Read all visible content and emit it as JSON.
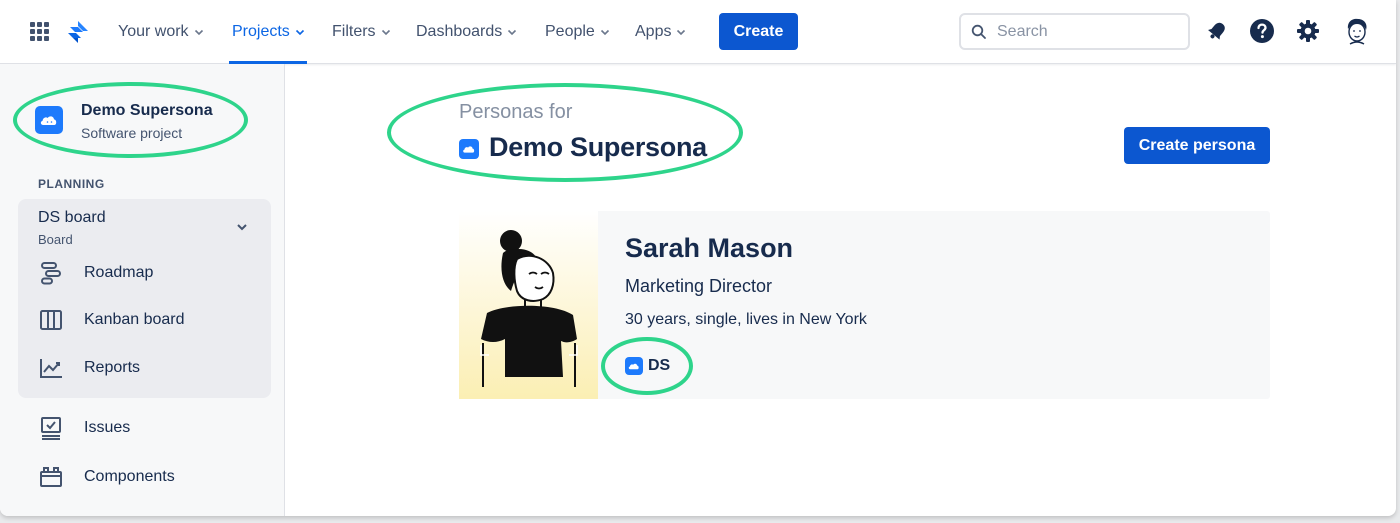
{
  "topnav": {
    "items": [
      {
        "label": "Your work"
      },
      {
        "label": "Projects"
      },
      {
        "label": "Filters"
      },
      {
        "label": "Dashboards"
      },
      {
        "label": "People"
      },
      {
        "label": "Apps"
      }
    ],
    "active": "Projects",
    "create_label": "Create",
    "search_placeholder": "Search"
  },
  "sidebar": {
    "project_name": "Demo Supersona",
    "project_type": "Software project",
    "section_label": "PLANNING",
    "board": {
      "title": "DS board",
      "subtitle": "Board"
    },
    "board_items": [
      {
        "label": "Roadmap",
        "icon": "roadmap-icon"
      },
      {
        "label": "Kanban board",
        "icon": "kanban-icon"
      },
      {
        "label": "Reports",
        "icon": "reports-icon"
      }
    ],
    "items": [
      {
        "label": "Issues",
        "icon": "issues-icon"
      },
      {
        "label": "Components",
        "icon": "components-icon"
      }
    ]
  },
  "main": {
    "eyebrow": "Personas for",
    "title": "Demo Supersona",
    "create_persona_label": "Create persona",
    "persona": {
      "name": "Sarah Mason",
      "role": "Marketing Director",
      "description": "30 years, single, lives in New York",
      "project_key": "DS"
    }
  },
  "colors": {
    "primary": "#0c57d0",
    "active_nav": "#0c66e4",
    "highlight": "#2ed48b",
    "project_icon": "#1d7afc"
  }
}
